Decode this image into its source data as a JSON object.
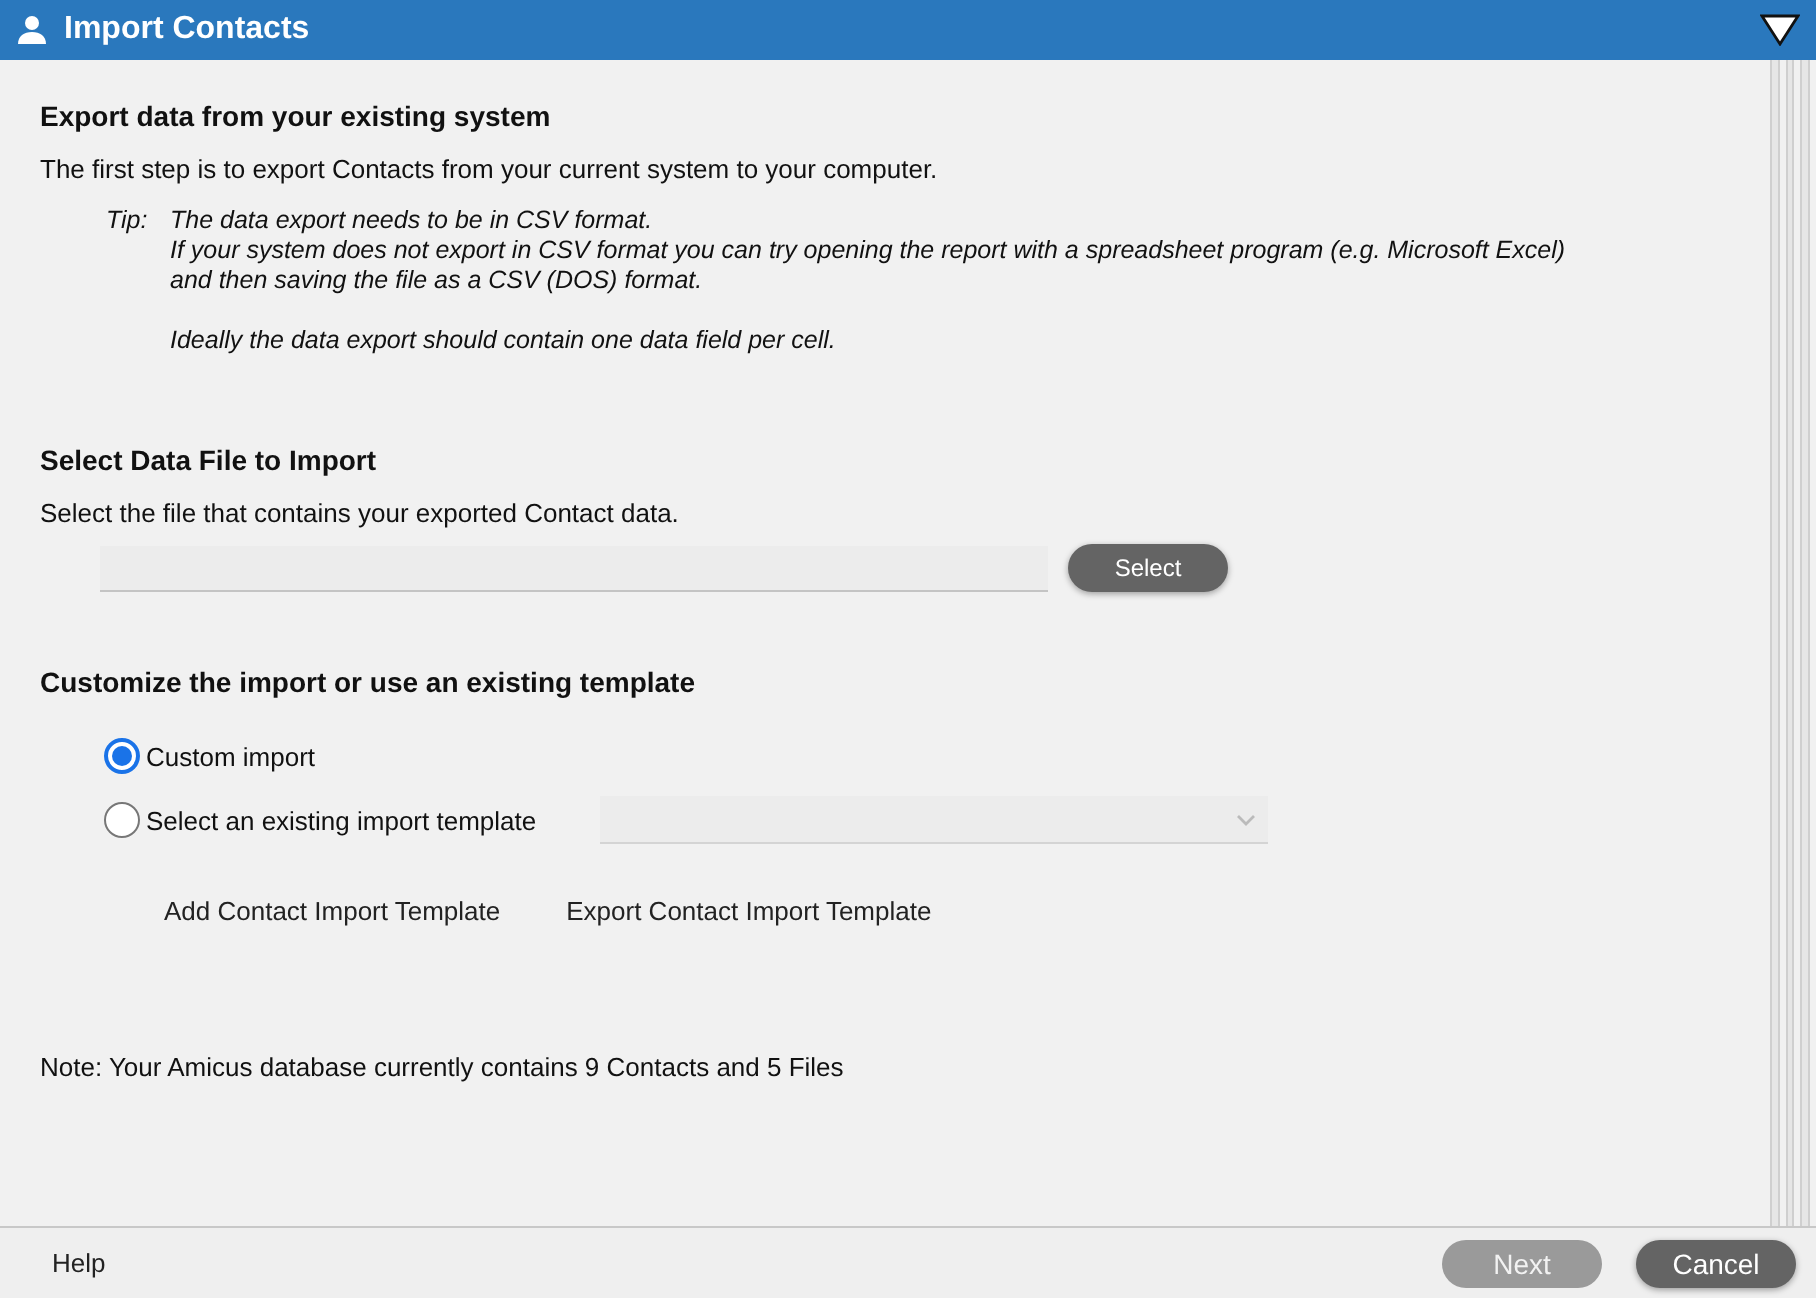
{
  "window": {
    "title": "Import Contacts"
  },
  "export_section": {
    "heading": "Export data from your existing system",
    "text": "The first step is to export Contacts from your current system to your computer.",
    "tip_label": "Tip:",
    "tip_paragraphs": [
      [
        "The data export needs to be in CSV format.",
        "If your system does not export in CSV format you can try opening the report with a spreadsheet program (e.g. Microsoft Excel)",
        "and then saving the file as a CSV (DOS) format."
      ],
      [
        "Ideally the data export should contain one data field per cell."
      ]
    ]
  },
  "file_section": {
    "heading": "Select Data File to Import",
    "text": "Select the file that contains your exported Contact data.",
    "select_button": "Select"
  },
  "template_section": {
    "heading": "Customize the import or use an existing template",
    "options": [
      {
        "label": "Custom import",
        "selected": true
      },
      {
        "label": "Select an existing import template",
        "selected": false
      }
    ],
    "links": [
      "Add Contact Import Template",
      "Export Contact Import Template"
    ]
  },
  "note": "Note: Your Amicus database currently contains 9 Contacts and 5 Files",
  "footer": {
    "help": "Help",
    "buttons": [
      {
        "label": "Next",
        "disabled": true
      },
      {
        "label": "Cancel",
        "disabled": false
      }
    ]
  }
}
